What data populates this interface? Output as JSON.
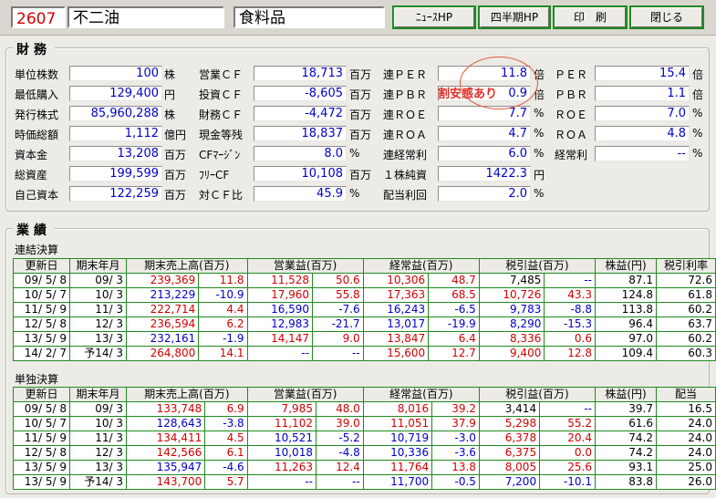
{
  "header": {
    "code": "2607",
    "company": "不二油",
    "industry": "食料品",
    "buttons": [
      "ﾆｭｰｽHP",
      "四半期HP",
      "印　刷",
      "閉じる"
    ]
  },
  "zaimu": {
    "title": "財務",
    "annotation": "割安感あり",
    "fields": [
      {
        "label": "単位株数",
        "value": "100",
        "unit": "株"
      },
      {
        "label": "最低購入",
        "value": "129,400",
        "unit": "円"
      },
      {
        "label": "発行株式",
        "value": "85,960,288",
        "unit": "株"
      },
      {
        "label": "時価総額",
        "value": "1,112",
        "unit": "億円"
      },
      {
        "label": "資本金",
        "value": "13,208",
        "unit": "百万"
      },
      {
        "label": "総資産",
        "value": "199,599",
        "unit": "百万"
      },
      {
        "label": "自己資本",
        "value": "122,259",
        "unit": "百万"
      },
      {
        "label": "営業ＣＦ",
        "value": "18,713",
        "unit": "百万"
      },
      {
        "label": "投資ＣＦ",
        "value": "-8,605",
        "unit": "百万"
      },
      {
        "label": "財務ＣＦ",
        "value": "-4,472",
        "unit": "百万"
      },
      {
        "label": "現金等残",
        "value": "18,837",
        "unit": "百万"
      },
      {
        "label": "CFﾏｰｼﾞﾝ",
        "value": "8.0",
        "unit": "%"
      },
      {
        "label": "ﾌﾘｰCF",
        "value": "10,108",
        "unit": "百万"
      },
      {
        "label": "対ＣＦ比",
        "value": "45.9",
        "unit": "%"
      },
      {
        "label": "連ＰＥＲ",
        "value": "11.8",
        "unit": "倍"
      },
      {
        "label": "連ＰＢＲ",
        "value": "0.9",
        "unit": "倍"
      },
      {
        "label": "連ＲＯＥ",
        "value": "7.7",
        "unit": "%"
      },
      {
        "label": "連ＲＯＡ",
        "value": "4.7",
        "unit": "%"
      },
      {
        "label": "連経常利",
        "value": "6.0",
        "unit": "%"
      },
      {
        "label": "１株純資",
        "value": "1422.3",
        "unit": "円"
      },
      {
        "label": "配当利回",
        "value": "2.0",
        "unit": "%"
      },
      {
        "label": "ＰＥＲ",
        "value": "15.4",
        "unit": "倍"
      },
      {
        "label": "ＰＢＲ",
        "value": "1.1",
        "unit": "倍"
      },
      {
        "label": "ＲＯＥ",
        "value": "7.0",
        "unit": "%"
      },
      {
        "label": "ＲＯＡ",
        "value": "4.8",
        "unit": "%"
      },
      {
        "label": "経常利",
        "value": "--",
        "unit": "%"
      }
    ]
  },
  "gyoseki": {
    "title": "業績",
    "renketsu": {
      "label": "連結決算",
      "headers": [
        "更新日",
        "期末年月",
        "期末売上高(百万)",
        "営業益(百万)",
        "経常益(百万)",
        "税引益(百万)",
        "株益(円)",
        "税引利率"
      ],
      "rows": [
        [
          "09/ 5/ 8",
          "09/ 3",
          "239,369",
          "11.8",
          "11,528",
          "50.6",
          "10,306",
          "48.7",
          "7,485",
          "--",
          "87.1",
          "72.6"
        ],
        [
          "10/ 5/ 7",
          "10/ 3",
          "213,229",
          "-10.9",
          "17,960",
          "55.8",
          "17,363",
          "68.5",
          "10,726",
          "43.3",
          "124.8",
          "61.8"
        ],
        [
          "11/ 5/ 9",
          "11/ 3",
          "222,714",
          "4.4",
          "16,590",
          "-7.6",
          "16,243",
          "-6.5",
          "9,783",
          "-8.8",
          "113.8",
          "60.2"
        ],
        [
          "12/ 5/ 8",
          "12/ 3",
          "236,594",
          "6.2",
          "12,983",
          "-21.7",
          "13,017",
          "-19.9",
          "8,290",
          "-15.3",
          "96.4",
          "63.7"
        ],
        [
          "13/ 5/ 9",
          "13/ 3",
          "232,161",
          "-1.9",
          "14,147",
          "9.0",
          "13,847",
          "6.4",
          "8,336",
          "0.6",
          "97.0",
          "60.2"
        ],
        [
          "14/ 2/ 7",
          "予14/ 3",
          "264,800",
          "14.1",
          "--",
          "--",
          "15,600",
          "12.7",
          "9,400",
          "12.8",
          "109.4",
          "60.3"
        ]
      ]
    },
    "tandoku": {
      "label": "単独決算",
      "headers": [
        "更新日",
        "期末年月",
        "期末売上高(百万)",
        "営業益(百万)",
        "経常益(百万)",
        "税引益(百万)",
        "株益(円)",
        "配当"
      ],
      "rows": [
        [
          "09/ 5/ 8",
          "09/ 3",
          "133,748",
          "6.9",
          "7,985",
          "48.0",
          "8,016",
          "39.2",
          "3,414",
          "--",
          "39.7",
          "16.5"
        ],
        [
          "10/ 5/ 7",
          "10/ 3",
          "128,643",
          "-3.8",
          "11,102",
          "39.0",
          "11,051",
          "37.9",
          "5,298",
          "55.2",
          "61.6",
          "24.0"
        ],
        [
          "11/ 5/ 9",
          "11/ 3",
          "134,411",
          "4.5",
          "10,521",
          "-5.2",
          "10,719",
          "-3.0",
          "6,378",
          "20.4",
          "74.2",
          "24.0"
        ],
        [
          "12/ 5/ 8",
          "12/ 3",
          "142,566",
          "6.1",
          "10,018",
          "-4.8",
          "10,336",
          "-3.6",
          "6,375",
          "0.0",
          "74.2",
          "24.0"
        ],
        [
          "13/ 5/ 9",
          "13/ 3",
          "135,947",
          "-4.6",
          "11,263",
          "12.4",
          "11,764",
          "13.8",
          "8,005",
          "25.6",
          "93.1",
          "25.0"
        ],
        [
          "13/ 5/ 9",
          "予14/ 3",
          "143,700",
          "5.7",
          "--",
          "--",
          "11,700",
          "-0.5",
          "7,200",
          "-10.1",
          "83.8",
          "26.0"
        ]
      ]
    }
  }
}
